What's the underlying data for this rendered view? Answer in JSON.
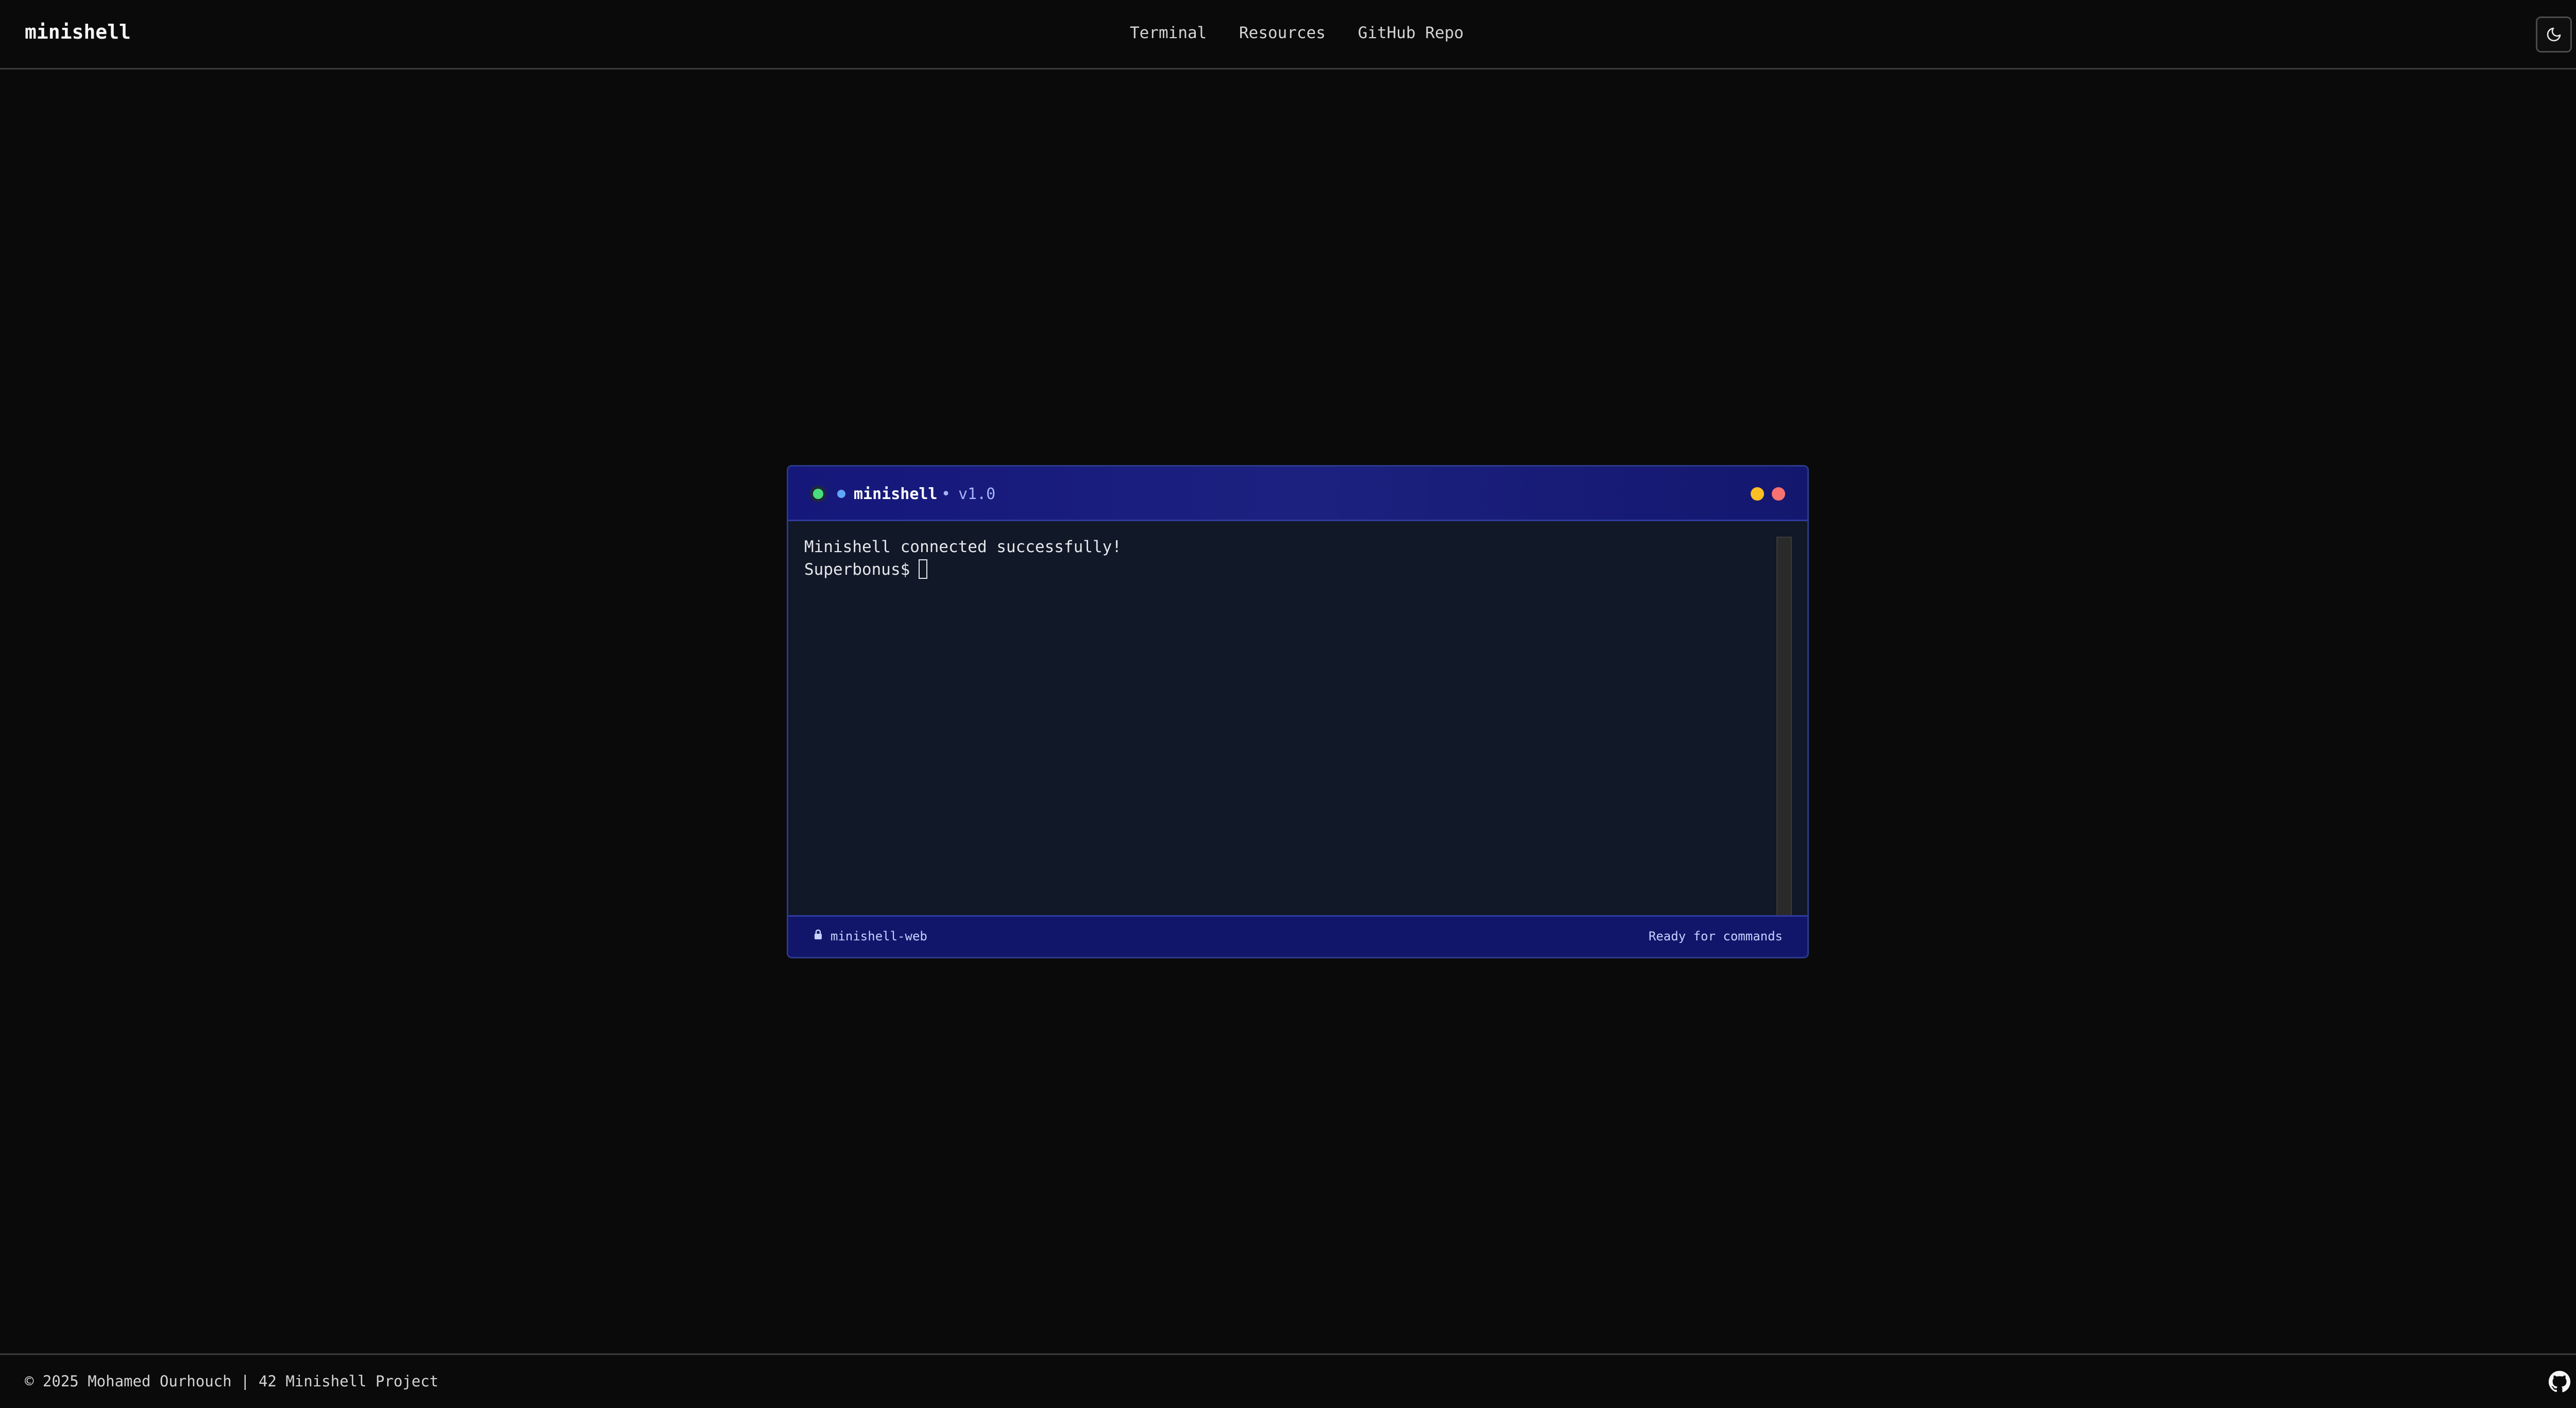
{
  "header": {
    "brand": "minishell",
    "nav": [
      "Terminal",
      "Resources",
      "GitHub Repo"
    ],
    "theme_toggle_icon": "moon-icon"
  },
  "terminal": {
    "title": "minishell",
    "separator": "•",
    "version": "v1.0",
    "status_color": "#4ade80",
    "lines": [
      "Minishell connected successfully!"
    ],
    "prompt": "Superbonus$",
    "footer_icon": "lock-icon",
    "footer_left": "minishell-web",
    "footer_right": "Ready for commands"
  },
  "footer": {
    "copyright": "© 2025 Mohamed Ourhouch | 42 Minishell Project",
    "github_icon": "github-icon"
  }
}
